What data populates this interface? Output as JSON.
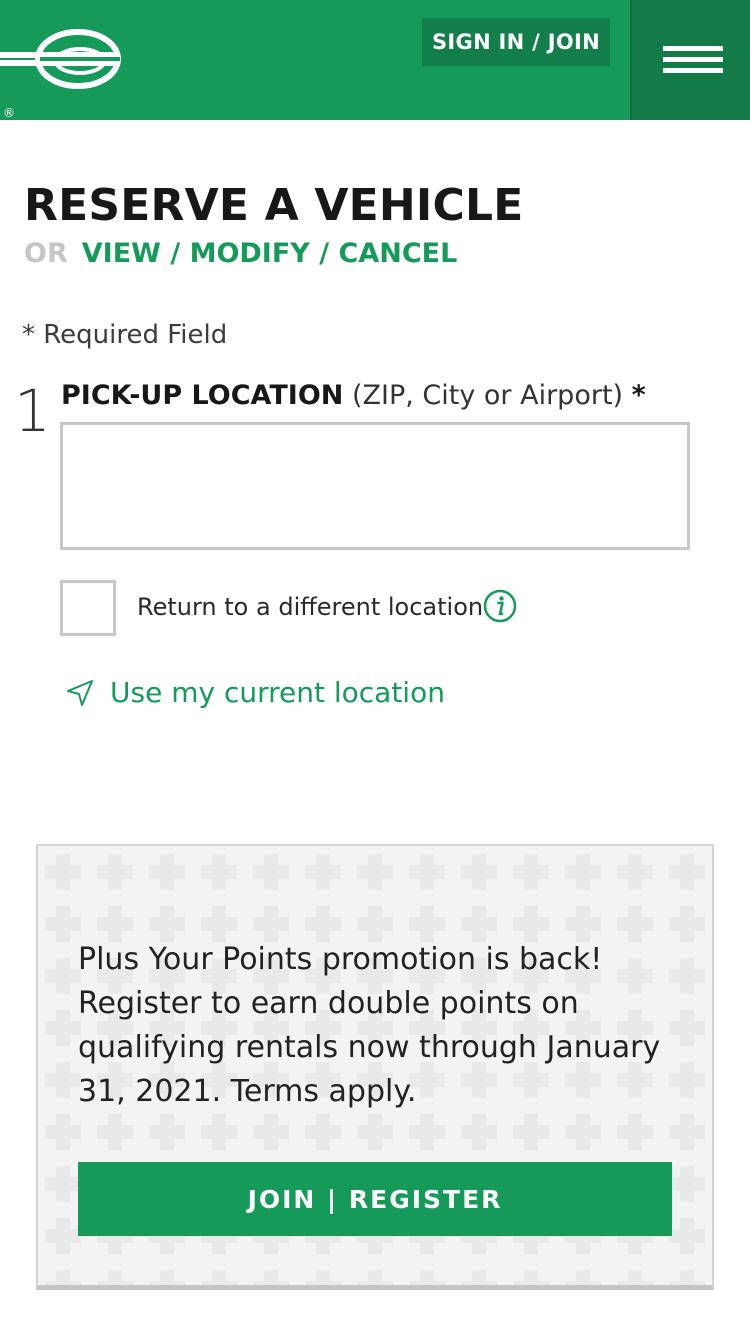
{
  "header": {
    "logo_name": "enterprise-e-logo",
    "registered_mark": "®",
    "signin_label": "SIGN IN / JOIN",
    "menu_icon": "hamburger-menu-icon"
  },
  "page": {
    "title": "RESERVE A VEHICLE",
    "or_label": "OR",
    "view_modify_cancel": "VIEW / MODIFY / CANCEL",
    "required_note": "* Required Field"
  },
  "pickup": {
    "step_number": "1",
    "label": "PICK-UP LOCATION",
    "hint": "(ZIP, City or Airport)",
    "required_star": "*",
    "value": "",
    "placeholder": ""
  },
  "return_option": {
    "label": "Return to a different location",
    "checked": false,
    "info_icon": "info-icon"
  },
  "current_location": {
    "label": "Use my current location",
    "icon": "location-arrow-icon"
  },
  "promo": {
    "text": "Plus Your Points promotion is back! Register to earn double points on qualifying rentals now through January 31, 2021. Terms apply.",
    "button_label": "JOIN | REGISTER"
  },
  "colors": {
    "brand_green": "#169a5a",
    "dark_green": "#127f4a",
    "text": "#181818",
    "muted": "#c6c6c6"
  }
}
